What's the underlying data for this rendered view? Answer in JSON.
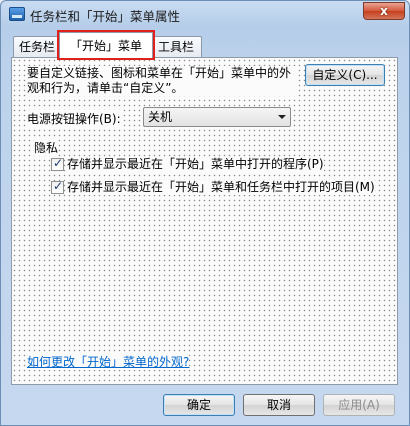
{
  "window": {
    "title": "任务栏和「开始」菜单属性",
    "close_label": "x"
  },
  "tabs": [
    {
      "label": "任务栏"
    },
    {
      "label": "「开始」菜单"
    },
    {
      "label": "工具栏"
    }
  ],
  "panel": {
    "intro_text": "要自定义链接、图标和菜单在「开始」菜单中的外观和行为，请单击“自定义”。",
    "customize_button": "自定义(C)...",
    "power_label": "电源按钮操作(B):",
    "power_value": "关机",
    "privacy_label": "隐私",
    "privacy_items": [
      {
        "label": "存储并显示最近在「开始」菜单中打开的程序(P)",
        "checked": true
      },
      {
        "label": "存储并显示最近在「开始」菜单和任务栏中打开的项目(M)",
        "checked": true
      }
    ],
    "help_link": "如何更改「开始」菜单的外观?"
  },
  "footer": {
    "ok": "确定",
    "cancel": "取消",
    "apply": "应用(A)"
  },
  "colors": {
    "highlight": "#e0201c",
    "link": "#0066cc"
  }
}
